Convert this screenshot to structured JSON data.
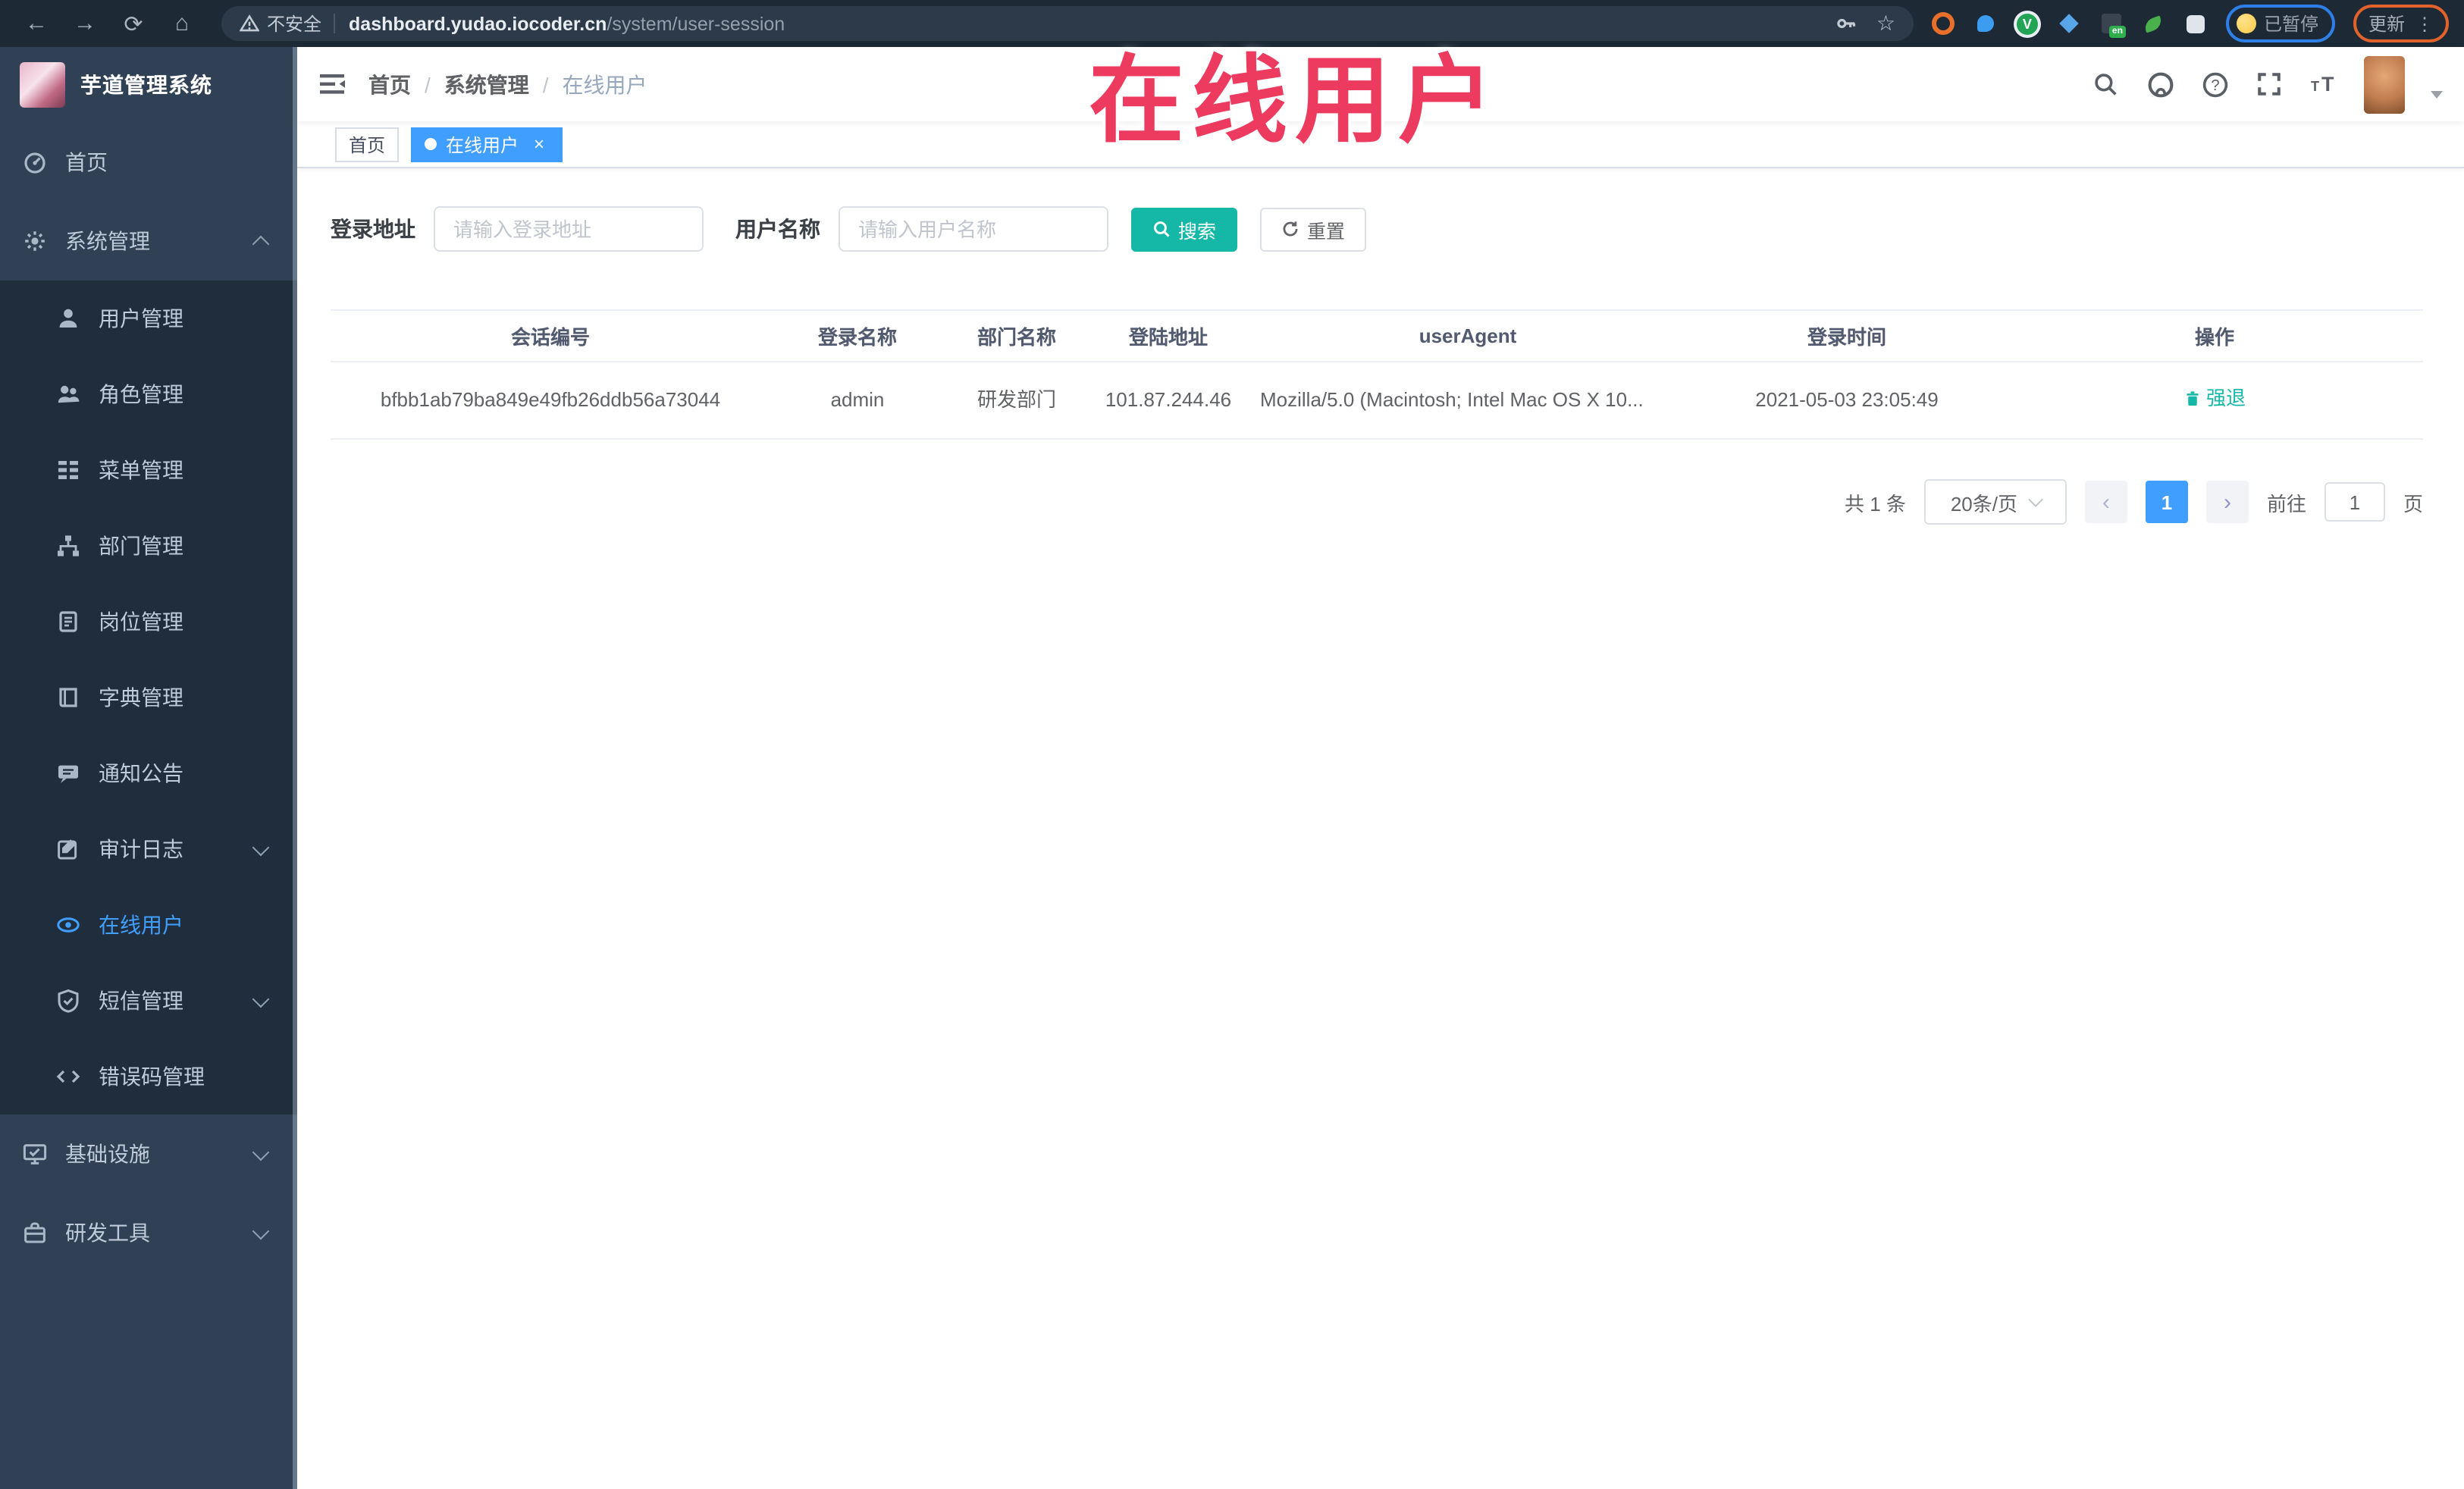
{
  "browser": {
    "security_label": "不安全",
    "url_host": "dashboard.yudao.iocoder.cn",
    "url_path": "/system/user-session",
    "paused_badge": "已暂停",
    "update_button": "更新",
    "extension_icons": [
      "orange-ring-icon",
      "blue-pin-icon",
      "green-v-icon",
      "blue-diamond-icon",
      "translate-en-icon",
      "green-leaf-icon",
      "puzzle-icon"
    ]
  },
  "overlay": {
    "title": "在线用户",
    "color": "#ed3b5f"
  },
  "sidebar": {
    "logo_title": "芋道管理系统",
    "items": [
      {
        "label": "首页",
        "icon": "dashboard-icon"
      },
      {
        "label": "系统管理",
        "icon": "gear-icon",
        "expanded": true
      },
      {
        "label": "用户管理",
        "icon": "user-icon"
      },
      {
        "label": "角色管理",
        "icon": "peoples-icon"
      },
      {
        "label": "菜单管理",
        "icon": "tree-table-icon"
      },
      {
        "label": "部门管理",
        "icon": "tree-icon"
      },
      {
        "label": "岗位管理",
        "icon": "post-icon"
      },
      {
        "label": "字典管理",
        "icon": "dict-icon"
      },
      {
        "label": "通知公告",
        "icon": "message-icon"
      },
      {
        "label": "审计日志",
        "icon": "log-icon",
        "collapsible": true
      },
      {
        "label": "在线用户",
        "icon": "online-icon",
        "active": true
      },
      {
        "label": "短信管理",
        "icon": "sms-icon",
        "collapsible": true
      },
      {
        "label": "错误码管理",
        "icon": "code-icon"
      },
      {
        "label": "基础设施",
        "icon": "monitor-icon",
        "collapsible": true
      },
      {
        "label": "研发工具",
        "icon": "tool-icon",
        "collapsible": true
      }
    ]
  },
  "header": {
    "breadcrumb": [
      "首页",
      "系统管理",
      "在线用户"
    ],
    "separator": "/"
  },
  "tags": {
    "home": "首页",
    "active_tab": "在线用户"
  },
  "filters": {
    "login_address_label": "登录地址",
    "login_address_placeholder": "请输入登录地址",
    "username_label": "用户名称",
    "username_placeholder": "请输入用户名称",
    "search_button": "搜索",
    "reset_button": "重置"
  },
  "table": {
    "columns": [
      "会话编号",
      "登录名称",
      "部门名称",
      "登陆地址",
      "userAgent",
      "登录时间",
      "操作"
    ],
    "rows": [
      {
        "session_id": "bfbb1ab79ba849e49fb26ddb56a73044",
        "login_name": "admin",
        "dept_name": "研发部门",
        "login_ip": "101.87.244.46",
        "user_agent": "Mozilla/5.0 (Macintosh; Intel Mac OS X 10...",
        "login_time": "2021-05-03 23:05:49",
        "action": "强退"
      }
    ]
  },
  "pagination": {
    "total": "共 1 条",
    "page_size": "20条/页",
    "current_page": "1",
    "goto_label": "前往",
    "goto_value": "1",
    "page_label": "页"
  },
  "colors": {
    "accent_blue": "#409eff",
    "teal": "#15b8a6",
    "sidebar_bg": "#304156",
    "submenu_bg": "#1f2d3d",
    "overlay_red": "#ed3b5f"
  }
}
